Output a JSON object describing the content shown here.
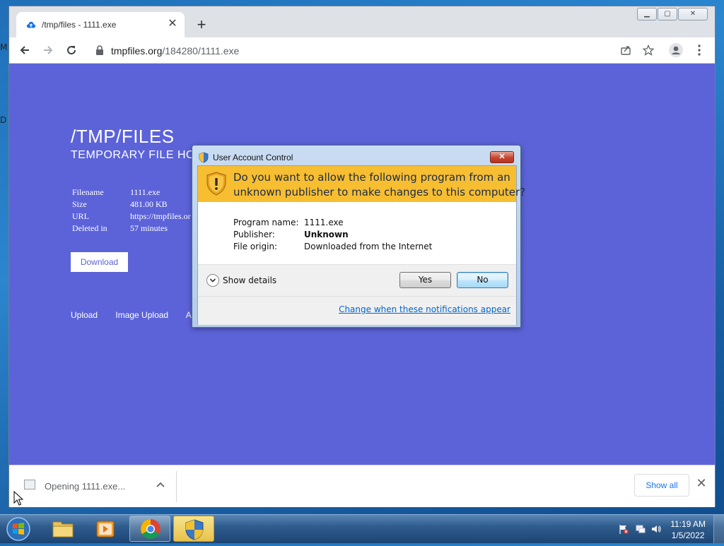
{
  "desktop": {
    "edge_letters": [
      "M",
      "D"
    ]
  },
  "browser": {
    "tab": {
      "title": "/tmp/files - 1111.exe",
      "favicon": "cloud-upload-icon",
      "close_glyph": "✕"
    },
    "new_tab_glyph": "+",
    "window_controls": {
      "minimize": "▁",
      "maximize": "▢",
      "close": "✕"
    },
    "toolbar": {
      "back": "arrow-left-icon",
      "forward": "arrow-right-icon",
      "reload": "reload-icon",
      "url_host": "tmpfiles.org",
      "url_path": "/184280/1111.exe",
      "share": "share-icon",
      "bookmark": "star-icon",
      "profile": "profile-icon",
      "menu": "kebab-menu-icon"
    },
    "page": {
      "background": "#5c63d8",
      "title": "/TMP/FILES",
      "subtitle": "TEMPORARY FILE HOS",
      "info": [
        {
          "key": "Filename",
          "value": "1111.exe"
        },
        {
          "key": "Size",
          "value": "481.00 KB"
        },
        {
          "key": "URL",
          "value": "https://tmpfiles.or"
        },
        {
          "key": "Deleted in",
          "value": "57 minutes"
        }
      ],
      "download_button": "Download",
      "links": [
        "Upload",
        "Image Upload",
        "A"
      ]
    },
    "download_bar": {
      "item": "Opening 1111.exe...",
      "show_all": "Show all",
      "close_glyph": "✕"
    }
  },
  "uac": {
    "title": "User Account Control",
    "close_glyph": "✕",
    "question_line1": "Do you want to allow the following program from an",
    "question_line2": "unknown publisher to make changes to this computer?",
    "details": [
      {
        "key": "Program name:",
        "value": "1111.exe",
        "bold": false
      },
      {
        "key": "Publisher:",
        "value": "Unknown",
        "bold": true
      },
      {
        "key": "File origin:",
        "value": "Downloaded from the Internet",
        "bold": false
      }
    ],
    "show_details": "Show details",
    "yes": "Yes",
    "no": "No",
    "change_link": "Change when these notifications appear",
    "banner_color": "#f7be31"
  },
  "taskbar": {
    "items": [
      "start-orb",
      "explorer",
      "media-player",
      "chrome",
      "uac-shield"
    ],
    "time": "11:19 AM",
    "date": "1/5/2022"
  }
}
